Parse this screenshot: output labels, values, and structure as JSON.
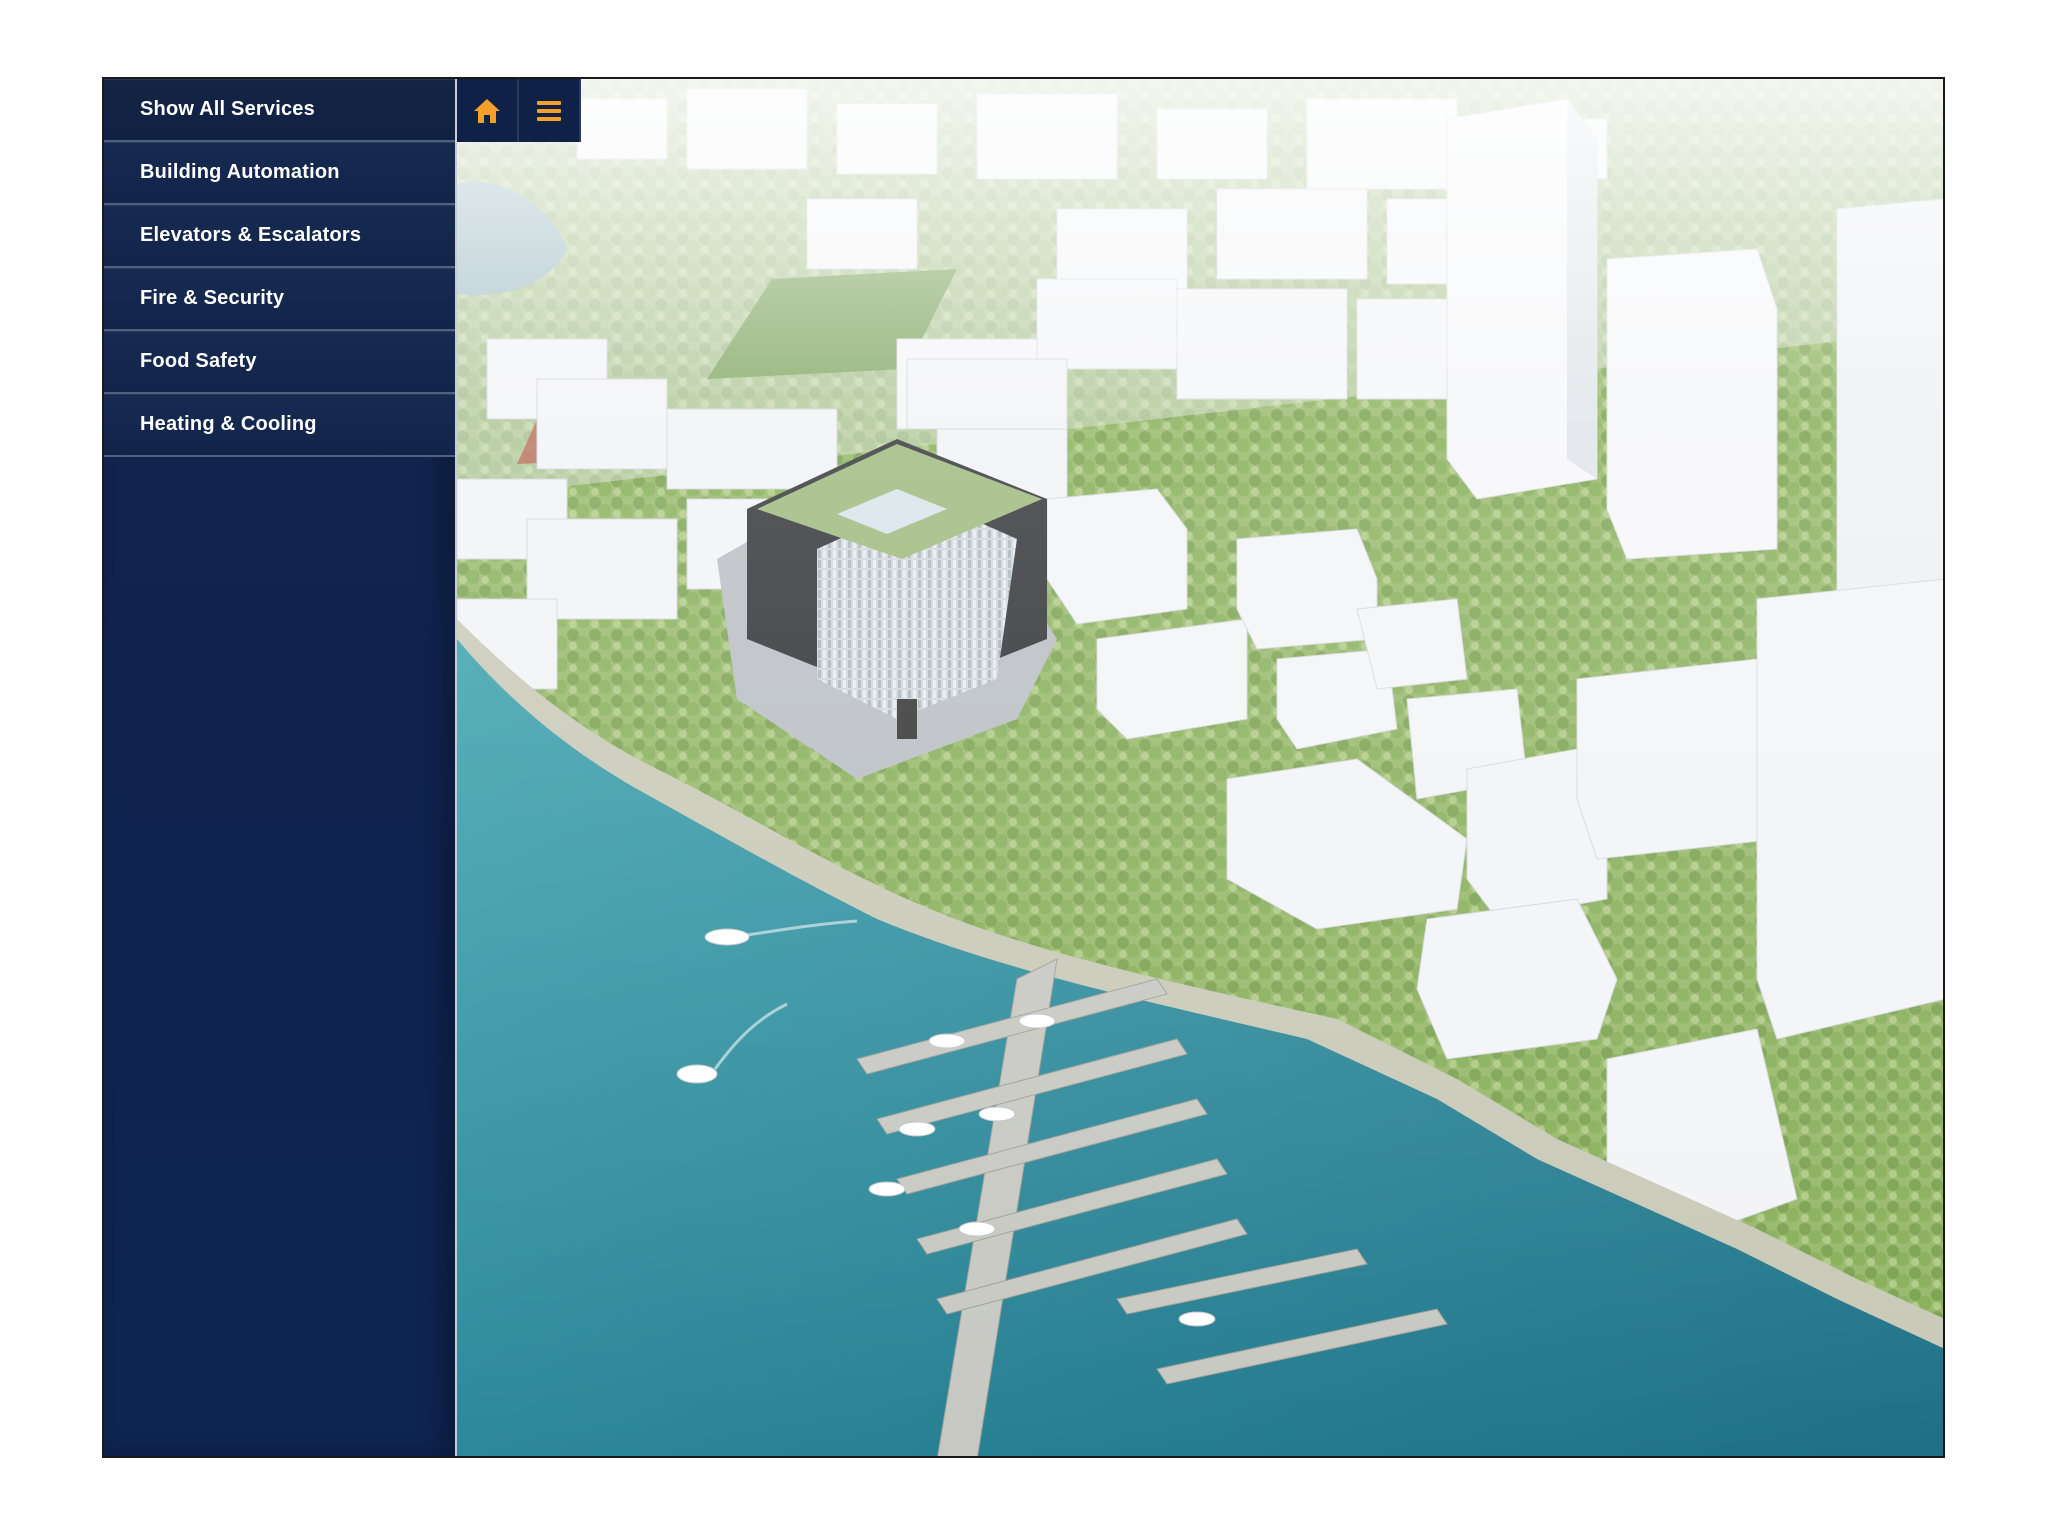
{
  "sidebar": {
    "items": [
      {
        "label": "Show All Services"
      },
      {
        "label": "Building Automation"
      },
      {
        "label": "Elevators & Escalators"
      },
      {
        "label": "Fire & Security"
      },
      {
        "label": "Food Safety"
      },
      {
        "label": "Heating & Cooling"
      }
    ]
  },
  "toolbar": {
    "home_icon": "home-icon",
    "menu_icon": "hamburger-menu-icon",
    "accent_color": "#f5a02a"
  },
  "scene": {
    "description_icon": "aerial-city-map",
    "colors": {
      "water": "#2f8a9a",
      "trees": "#7aa84a",
      "buildings": "#f2f3f5"
    }
  }
}
